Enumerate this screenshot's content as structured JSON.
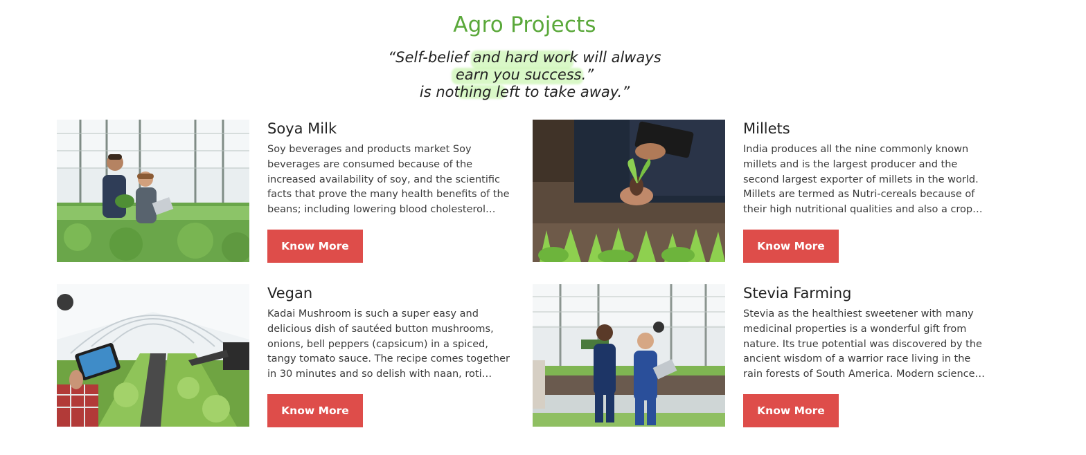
{
  "section": {
    "title": "Agro Projects",
    "quote": {
      "line1": "“Self-belief and hard work will always",
      "line2": "earn you success.”",
      "line3": "is nothing left to take away.”"
    }
  },
  "colors": {
    "title_green": "#5aa83a",
    "button_red": "#de4d4a",
    "highlight_green": "#b8f29a"
  },
  "projects": [
    {
      "title": "Soya Milk",
      "description": "Soy beverages and products market Soy beverages are consumed because of the increased availability of soy, and the scientific facts that prove the many health benefits of the beans; including lowering blood cholesterol and…",
      "button": "Know More"
    },
    {
      "title": "Millets",
      "description": "India produces all the nine commonly known millets and is the largest producer and the second largest exporter of millets in the world. Millets are termed as Nutri-cereals because of their high nutritional qualities and also a crop…",
      "button": "Know More"
    },
    {
      "title": "Vegan",
      "description": "Kadai Mushroom is such a super easy and delicious dish of sautéed button mushrooms, onions, bell peppers (capsicum) in a spiced, tangy tomato sauce. The recipe comes together in 30 minutes and so delish with naan, roti and…",
      "button": "Know More"
    },
    {
      "title": "Stevia Farming",
      "description": "Stevia as the healthiest sweetener with many medicinal properties is a wonderful gift from nature. Its true potential was discovered by the ancient wisdom of a warrior race living in the rain forests of South America. Modern science…",
      "button": "Know More"
    }
  ]
}
